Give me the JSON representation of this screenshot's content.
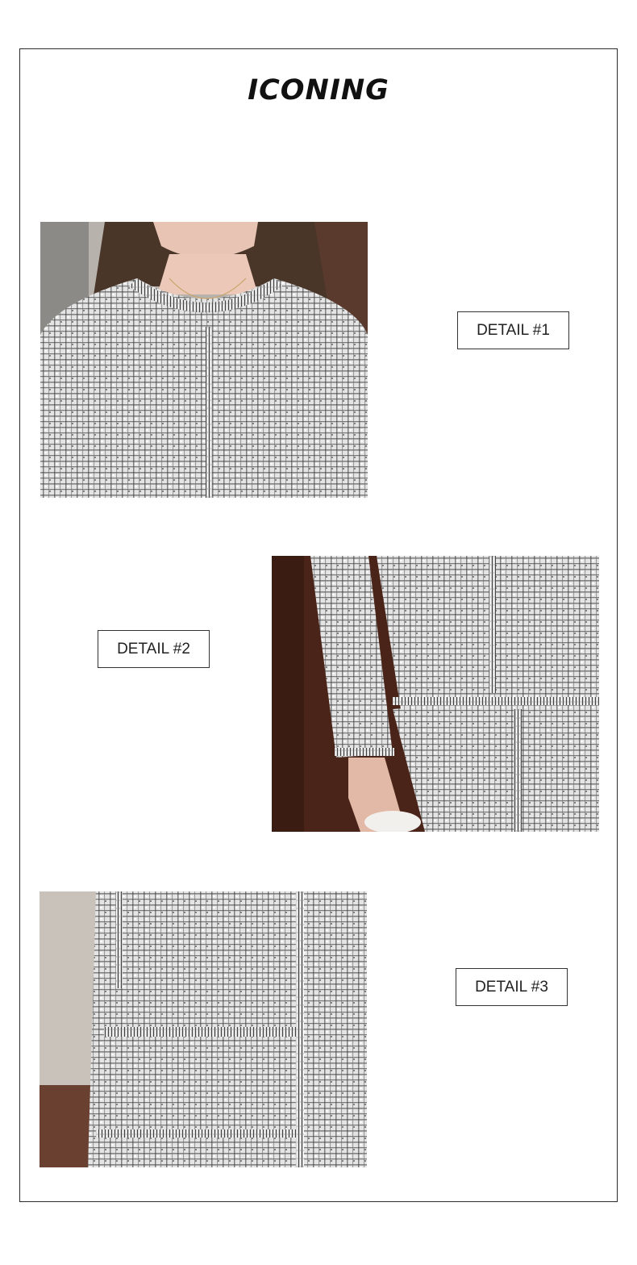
{
  "page": {
    "title": "ICONING"
  },
  "details": [
    {
      "label": "DETAIL #1",
      "image": "tweed-jacket-neckline-photo"
    },
    {
      "label": "DETAIL #2",
      "image": "tweed-jacket-sleeve-skirt-photo"
    },
    {
      "label": "DETAIL #3",
      "image": "tweed-jacket-pocket-photo"
    }
  ],
  "colors": {
    "border": "#2b2b2b",
    "tweed_light": "#e6e6e6",
    "tweed_dark": "#3a3a3a",
    "background_wood": "#4a2418",
    "skin": "#e8c4b4",
    "hair": "#4a3628"
  }
}
